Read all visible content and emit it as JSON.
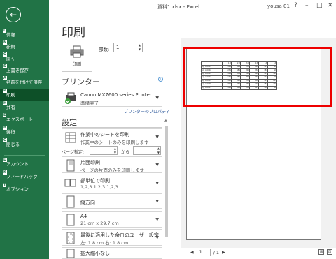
{
  "window": {
    "title": "資料1.xlsx  -  Excel",
    "user": "yousa 01",
    "help": "?",
    "minimize": "–",
    "restore": "□",
    "close": "✕"
  },
  "sidebar": {
    "back": "←",
    "items": [
      {
        "key": "I",
        "label": "情報"
      },
      {
        "key": "N",
        "label": "新規"
      },
      {
        "key": "O",
        "label": "開く"
      },
      {
        "key": "S",
        "label": "上書き保存"
      },
      {
        "key": "A",
        "label": "名前を付けて保存"
      },
      {
        "key": "P",
        "label": "印刷"
      },
      {
        "key": "H",
        "label": "共有"
      },
      {
        "key": "E",
        "label": "エクスポート"
      },
      {
        "key": "B",
        "label": "発行"
      },
      {
        "key": "C",
        "label": "閉じる"
      },
      {
        "key": "D",
        "label": "アカウント"
      },
      {
        "key": "K",
        "label": "フィードバック"
      },
      {
        "key": "T",
        "label": "オプション"
      }
    ]
  },
  "print": {
    "title": "印刷",
    "button_label": "印刷",
    "copies_label": "部数:",
    "copies_value": "1"
  },
  "printer": {
    "heading": "プリンター",
    "name": "Canon MX7600 series Printer",
    "status": "準備完了",
    "properties_link": "プリンターのプロパティ"
  },
  "settings": {
    "heading": "設定",
    "items": [
      {
        "t1": "作業中のシートを印刷",
        "t2": "作業中のシートのみを印刷します"
      },
      {
        "t1": "片面印刷",
        "t2": "ページの片面のみを印刷します"
      },
      {
        "t1": "部単位で印刷",
        "t2": "1,2,3    1,2,3    1,2,3"
      },
      {
        "t1": "縦方向",
        "t2": ""
      },
      {
        "t1": "A4",
        "t2": "21 cm x 29.7 cm"
      },
      {
        "t1": "最後に適用した余白のユーザー設定",
        "t2": "左:  1.8 cm    右:  1.8 cm"
      },
      {
        "t1": "拡大縮小なし",
        "t2": ""
      }
    ],
    "pages_label": "ページ指定:",
    "pages_to": "から"
  },
  "preview": {
    "page_current": "1",
    "page_total": "/ 1"
  },
  "mini_table": {
    "header": [
      "",
      "1月",
      "2月",
      "3月",
      "4月",
      "5月",
      "6月"
    ],
    "rows": [
      [
        "A社 A-0001",
        "121",
        "181",
        "230",
        "120",
        "123",
        "20"
      ],
      [
        "A社 A-0002",
        "231",
        "181",
        "200",
        "232",
        "181",
        "20"
      ],
      [
        "A社 A-0003",
        "121",
        "131",
        "260",
        "120",
        "123",
        "120"
      ],
      [
        "A社 A-0004",
        "130",
        "450",
        "700",
        "240",
        "123",
        "20"
      ],
      [
        "A社 A-0005",
        "123",
        "360",
        "230",
        "150",
        "123",
        "201"
      ],
      [
        "A社 A-0006",
        "300",
        "240",
        "230",
        "120",
        "183",
        "200"
      ],
      [
        "A社 A-0007",
        "120",
        "181",
        "230",
        "121",
        "300",
        "40"
      ]
    ]
  }
}
